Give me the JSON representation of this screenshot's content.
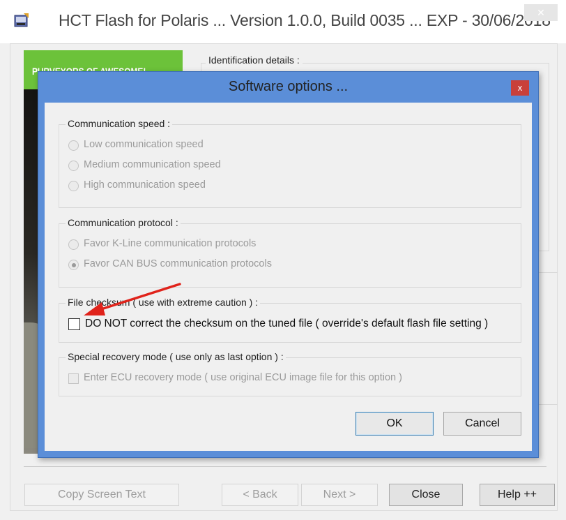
{
  "window": {
    "title": "HCT Flash for Polaris ... Version 1.0.0, Build 0035 ... EXP - 30/06/2018",
    "close_label": "✕",
    "icon": "app-icon"
  },
  "banner": {
    "text": "PURVEYORS OF AWESOME!"
  },
  "identification": {
    "label": "Identification details :"
  },
  "main_buttons": {
    "copy": "Copy Screen Text",
    "back": "< Back",
    "next": "Next >",
    "close": "Close",
    "help": "Help ++"
  },
  "dialog": {
    "title": "Software options ...",
    "close_label": "x",
    "speed": {
      "label": "Communication speed :",
      "options": [
        "Low communication speed",
        "Medium communication speed",
        "High communication speed"
      ],
      "selected": null
    },
    "protocol": {
      "label": "Communication protocol :",
      "options": [
        "Favor K-Line communication protocols",
        "Favor CAN BUS communication protocols"
      ],
      "selected": 1
    },
    "checksum": {
      "label": "File checksum ( use with extreme caution ) :",
      "option": "DO NOT correct the checksum on the tuned file ( override's default flash file setting )",
      "checked": false
    },
    "recovery": {
      "label": "Special recovery mode ( use only as last option ) :",
      "option": "Enter ECU recovery mode ( use original ECU image file for this option )",
      "checked": false
    },
    "ok": "OK",
    "cancel": "Cancel"
  },
  "colors": {
    "dialog_frame": "#5b8ed8",
    "close_red": "#c9403a",
    "banner_green": "#6cc23a",
    "annotation_arrow": "#e0231b"
  }
}
